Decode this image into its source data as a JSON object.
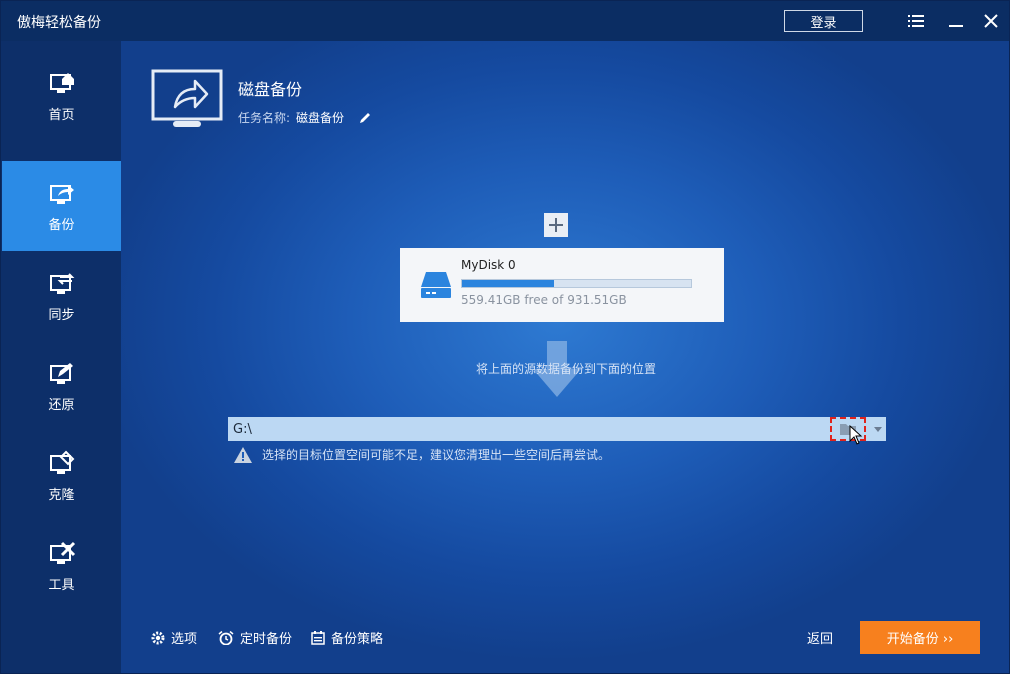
{
  "window": {
    "title": "傲梅轻松备份",
    "login_label": "登录"
  },
  "sidebar": {
    "items": [
      {
        "label": "首页",
        "icon": "home-monitor-icon"
      },
      {
        "label": "备份",
        "icon": "backup-monitor-icon"
      },
      {
        "label": "同步",
        "icon": "sync-monitor-icon"
      },
      {
        "label": "还原",
        "icon": "restore-monitor-icon"
      },
      {
        "label": "克隆",
        "icon": "clone-monitor-icon"
      },
      {
        "label": "工具",
        "icon": "tools-monitor-icon"
      }
    ],
    "active_index": 1
  },
  "task": {
    "title": "磁盘备份",
    "name_label": "任务名称:",
    "name_value": "磁盘备份"
  },
  "source": {
    "disk_name": "MyDisk 0",
    "free_text": "559.41GB free of 931.51GB",
    "used_fraction": 0.4
  },
  "flow_text": "将上面的源数据备份到下面的位置",
  "destination": {
    "value": "G:\\"
  },
  "warning": "选择的目标位置空间可能不足，建议您清理出一些空间后再尝试。",
  "footer": {
    "options_label": "选项",
    "schedule_label": "定时备份",
    "scheme_label": "备份策略",
    "back_label": "返回",
    "start_label": "开始备份 ››"
  },
  "colors": {
    "accent": "#2b8be6",
    "start_button": "#f7801e",
    "warning_border": "#e0231c"
  }
}
